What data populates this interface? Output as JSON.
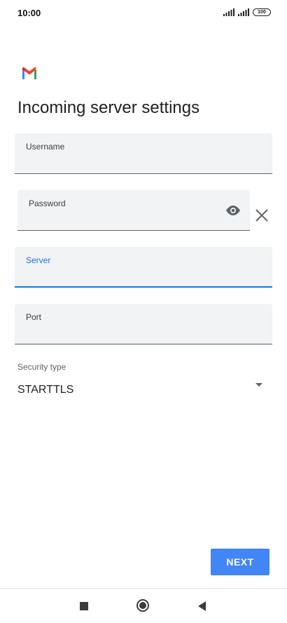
{
  "status_bar": {
    "time": "10:00",
    "battery": "100",
    "icons": [
      "signal-icon",
      "signal-icon",
      "battery-icon"
    ]
  },
  "app": {
    "logo_icon": "gmail-logo-icon",
    "title": "Incoming server settings"
  },
  "form": {
    "username": {
      "label": "Username",
      "value": ""
    },
    "password": {
      "label": "Password",
      "value": "",
      "icons": [
        "eye-icon",
        "clear-icon"
      ]
    },
    "server": {
      "label": "Server",
      "value": "",
      "focused": true
    },
    "port": {
      "label": "Port",
      "value": ""
    },
    "security": {
      "label": "Security type",
      "value": "STARTTLS",
      "icon": "dropdown-arrow-icon"
    }
  },
  "actions": {
    "next_label": "NEXT"
  },
  "nav_bar": {
    "icons": [
      "recents-icon",
      "home-icon",
      "back-icon"
    ]
  },
  "colors": {
    "accent": "#1a73e8",
    "button": "#4285f4",
    "field_bg": "#f1f3f4"
  }
}
